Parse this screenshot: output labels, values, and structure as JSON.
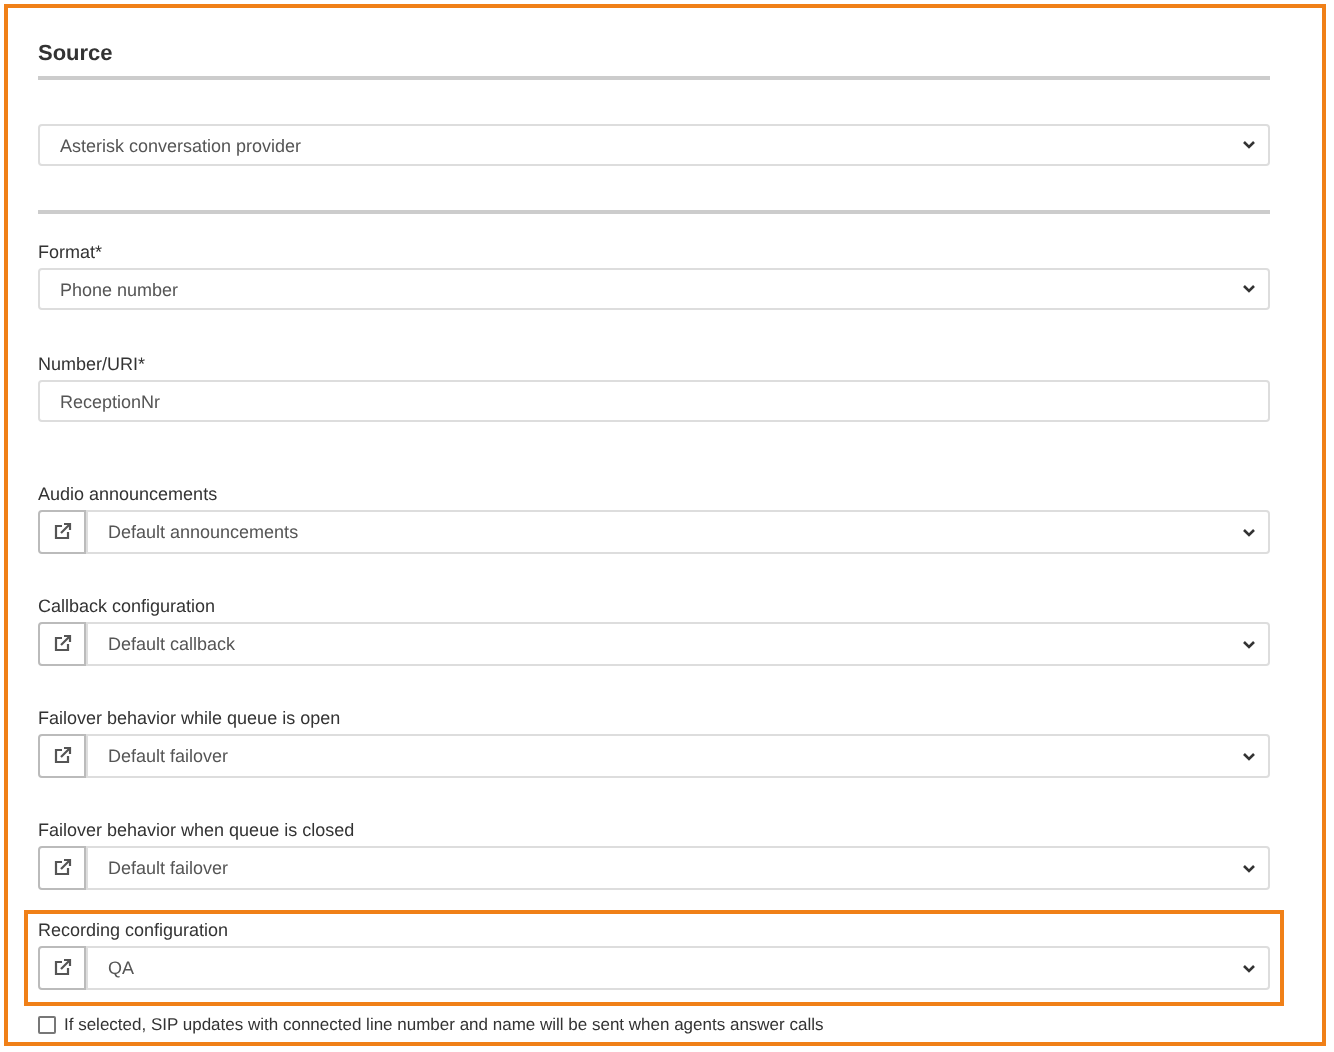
{
  "section_title": "Source",
  "provider": {
    "value": "Asterisk conversation provider"
  },
  "fields": [
    {
      "kind": "select",
      "label": "Format*",
      "value": "Phone number",
      "highlighted": false
    },
    {
      "kind": "input",
      "label": "Number/URI*",
      "value": "ReceptionNr",
      "highlighted": false
    },
    {
      "kind": "link-select",
      "label": "Audio announcements",
      "value": "Default announcements",
      "highlighted": false
    },
    {
      "kind": "link-select",
      "label": "Callback configuration",
      "value": "Default callback",
      "highlighted": false
    },
    {
      "kind": "link-select",
      "label": "Failover behavior while queue is open",
      "value": "Default failover",
      "highlighted": false
    },
    {
      "kind": "link-select",
      "label": "Failover behavior when queue is closed",
      "value": "Default failover",
      "highlighted": false
    },
    {
      "kind": "link-select",
      "label": "Recording configuration",
      "value": "QA",
      "highlighted": true
    }
  ],
  "sip_option": {
    "label": "If selected, SIP updates with connected line number and name will be sent when agents answer calls",
    "checked": false
  }
}
